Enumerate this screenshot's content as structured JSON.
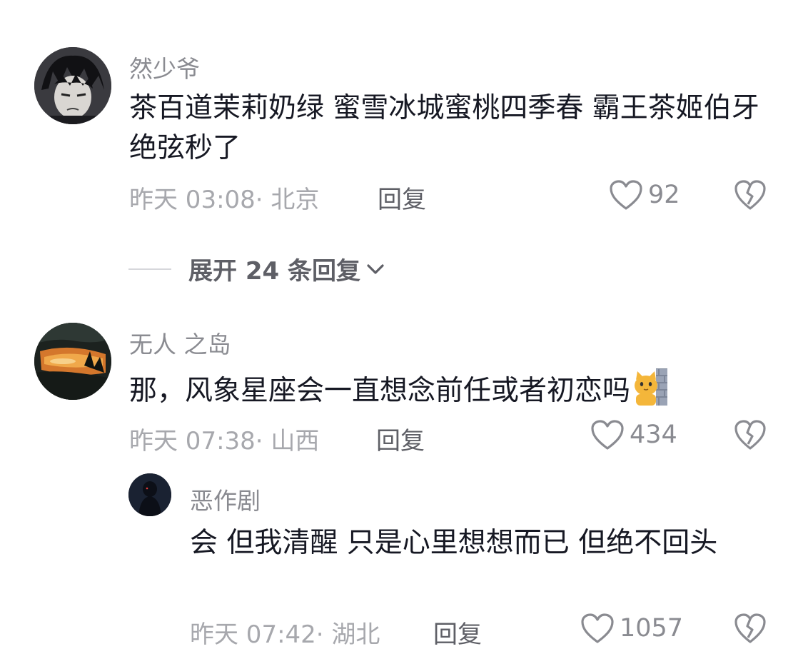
{
  "comments": [
    {
      "username": "然少爷",
      "text": "茶百道茉莉奶绿 蜜雪冰城蜜桃四季春 霸王茶姬伯牙绝弦秒了",
      "time": "昨天 03:08",
      "location": "· 北京",
      "reply_label": "回复",
      "likes": "92",
      "avatar_icon": "anime-boy-avatar"
    },
    {
      "username": "无人 之岛",
      "text": "那，风象星座会一直想念前任或者初恋吗",
      "emoji": "cat-peeking-emoji",
      "time": "昨天 07:38",
      "location": "· 山西",
      "reply_label": "回复",
      "likes": "434",
      "avatar_icon": "sunset-scenery-avatar"
    }
  ],
  "expand_replies": {
    "label": "展开 24 条回复"
  },
  "sub_reply": {
    "username": "恶作剧",
    "text": "会 但我清醒 只是心里想想而已 但绝不回头",
    "time": "昨天 07:42",
    "location": "· 湖北",
    "reply_label": "回复",
    "likes": "1057",
    "avatar_icon": "dark-figure-avatar"
  },
  "colors": {
    "primary_text": "#161823",
    "secondary_text": "#8a8b91",
    "meta_text": "#a7a8ad",
    "reply_text": "#5e5f66"
  }
}
